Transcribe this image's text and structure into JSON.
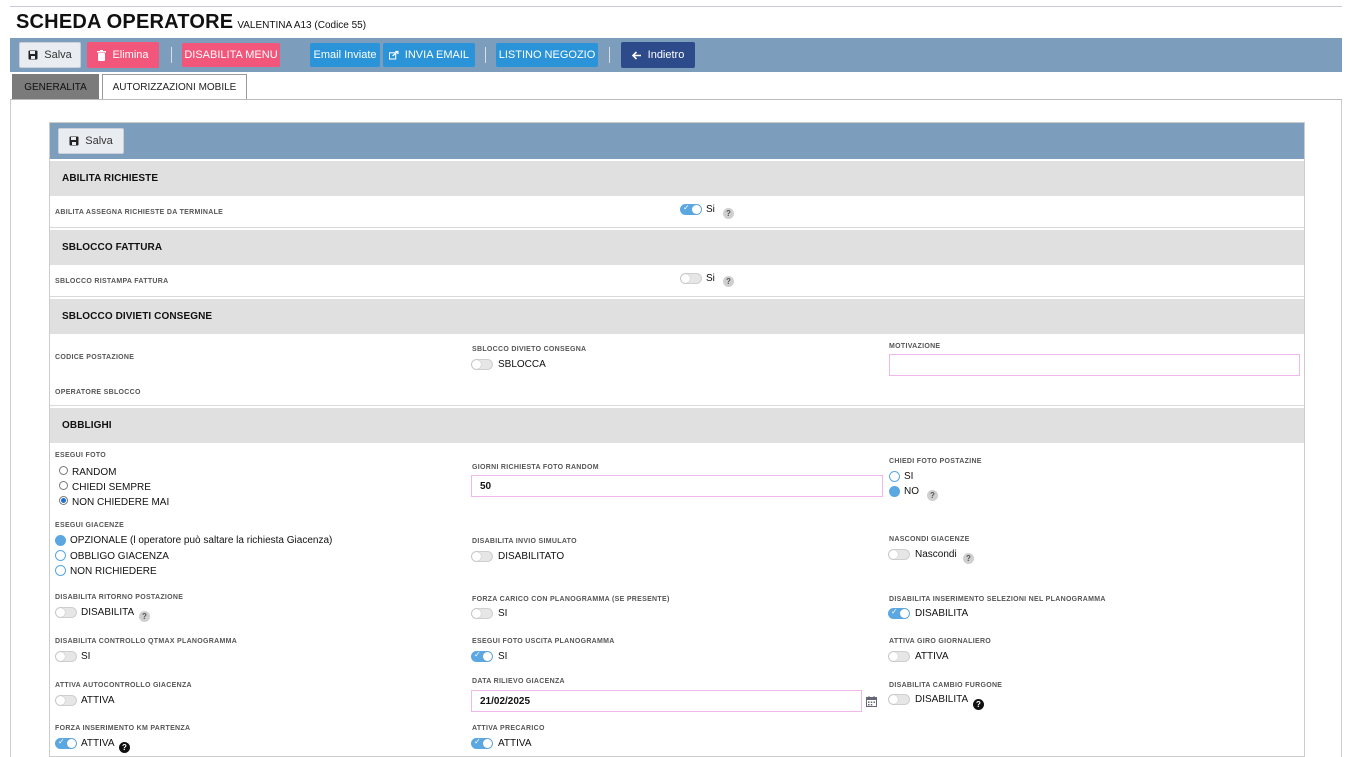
{
  "header": {
    "title": "SCHEDA OPERATORE",
    "subtitle": "VALENTINA A13 (Codice 55)"
  },
  "toolbar": {
    "save": "Salva",
    "delete": "Elimina",
    "disable_menu": "DISABILITA MENU",
    "emails_sent": "Email Inviate",
    "send_email": "INVIA EMAIL",
    "shop_list": "LISTINO NEGOZIO",
    "back": "Indietro"
  },
  "tabs": [
    "GENERALITA",
    "AUTORIZZAZIONI MOBILE"
  ],
  "panel": {
    "save": "Salva",
    "sections": {
      "abilita_richieste": {
        "title": "ABILITA RICHIESTE",
        "field_label": "ABILITA ASSEGNA RICHIESTE DA TERMINALE",
        "toggle_text": "Si",
        "toggle_on": true
      },
      "sblocco_fattura": {
        "title": "SBLOCCO FATTURA",
        "field_label": "SBLOCCO RISTAMPA FATTURA",
        "toggle_text": "Si",
        "toggle_on": false
      },
      "sblocco_divieti": {
        "title": "SBLOCCO DIVIETI CONSEGNE",
        "codice_postazione": "CODICE POSTAZIONE",
        "sblocco_divieto_label": "SBLOCCO DIVIETO CONSEGNA",
        "sblocco_text": "SBLOCCA",
        "motivazione_label": "MOTIVAZIONE",
        "motivazione_value": "",
        "operatore_sblocco": "OPERATORE SBLOCCO"
      },
      "obblighi": {
        "title": "OBBLIGHI",
        "esegui_foto": {
          "label": "ESEGUI FOTO",
          "options": [
            "RANDOM",
            "CHIEDI SEMPRE",
            "NON CHIEDERE MAI"
          ],
          "selected": "NON CHIEDERE MAI"
        },
        "giorni_foto": {
          "label": "GIORNI RICHIESTA FOTO RANDOM",
          "value": "50"
        },
        "chiedi_foto_postazine": {
          "label": "CHIEDI FOTO POSTAZINE",
          "options": [
            "SI",
            "NO"
          ],
          "selected": "NO"
        },
        "esegui_giacenze": {
          "label": "ESEGUI GIACENZE",
          "options": [
            "OPZIONALE (l operatore può saltare la richiesta Giacenza)",
            "OBBLIGO GIACENZA",
            "NON RICHIEDERE"
          ],
          "selected": "OPZIONALE (l operatore può saltare la richiesta Giacenza)"
        },
        "disabilita_invio": {
          "label": "DISABILITA INVIO SIMULATO",
          "text": "DISABILITATO",
          "on": false
        },
        "nascondi_giacenze": {
          "label": "NASCONDI GIACENZE",
          "text": "Nascondi",
          "on": false
        },
        "disabilita_ritorno": {
          "label": "DISABILITA RITORNO POSTAZIONE",
          "text": "DISABILITA",
          "on": false
        },
        "forza_carico": {
          "label": "FORZA CARICO CON PLANOGRAMMA (se presente)",
          "text": "SI",
          "on": false
        },
        "disabilita_inserimento": {
          "label": "DISABILITA INSERIMENTO SELEZIONI NEL PLANOGRAMMA",
          "text": "DISABILITA",
          "on": true
        },
        "disabilita_controllo": {
          "label": "DISABILITA CONTROLLO QTMAX PLANOGRAMMA",
          "text": "SI",
          "on": false
        },
        "esegui_foto_uscita": {
          "label": "ESEGUI FOTO USCITA PLANOGRAMMA",
          "text": "SI",
          "on": true
        },
        "attiva_giro": {
          "label": "ATTIVA GIRO GIORNALIERO",
          "text": "ATTIVA",
          "on": false
        },
        "attiva_autocontrollo": {
          "label": "ATTIVA AUTOCONTROLLO GIACENZA",
          "text": "ATTIVA",
          "on": false
        },
        "data_rilievo": {
          "label": "DATA RILIEVO GIACENZA",
          "value": "21/02/2025"
        },
        "disabilita_cambio": {
          "label": "DISABILITA CAMBIO FURGONE",
          "text": "DISABILITA",
          "on": false
        },
        "forza_km": {
          "label": "FORZA INSERIMENTO KM PARTENZA",
          "text": "ATTIVA",
          "on": true
        },
        "attiva_precarico": {
          "label": "ATTIVA PRECARICO",
          "text": "ATTIVA",
          "on": true
        }
      }
    }
  },
  "colors": {
    "toolbar_bg": "#7d9dbc",
    "red_button": "#f2567a",
    "blue_button": "#2b93d8",
    "navy_button": "#2d4a8a",
    "toggle_on": "#5aa7e2",
    "input_border": "#f0b8ec"
  },
  "icons": {
    "save": "floppy-icon",
    "delete": "trash-icon",
    "send_email": "share-icon",
    "back": "arrow-left-icon",
    "help": "question-icon",
    "calendar": "calendar-icon"
  }
}
